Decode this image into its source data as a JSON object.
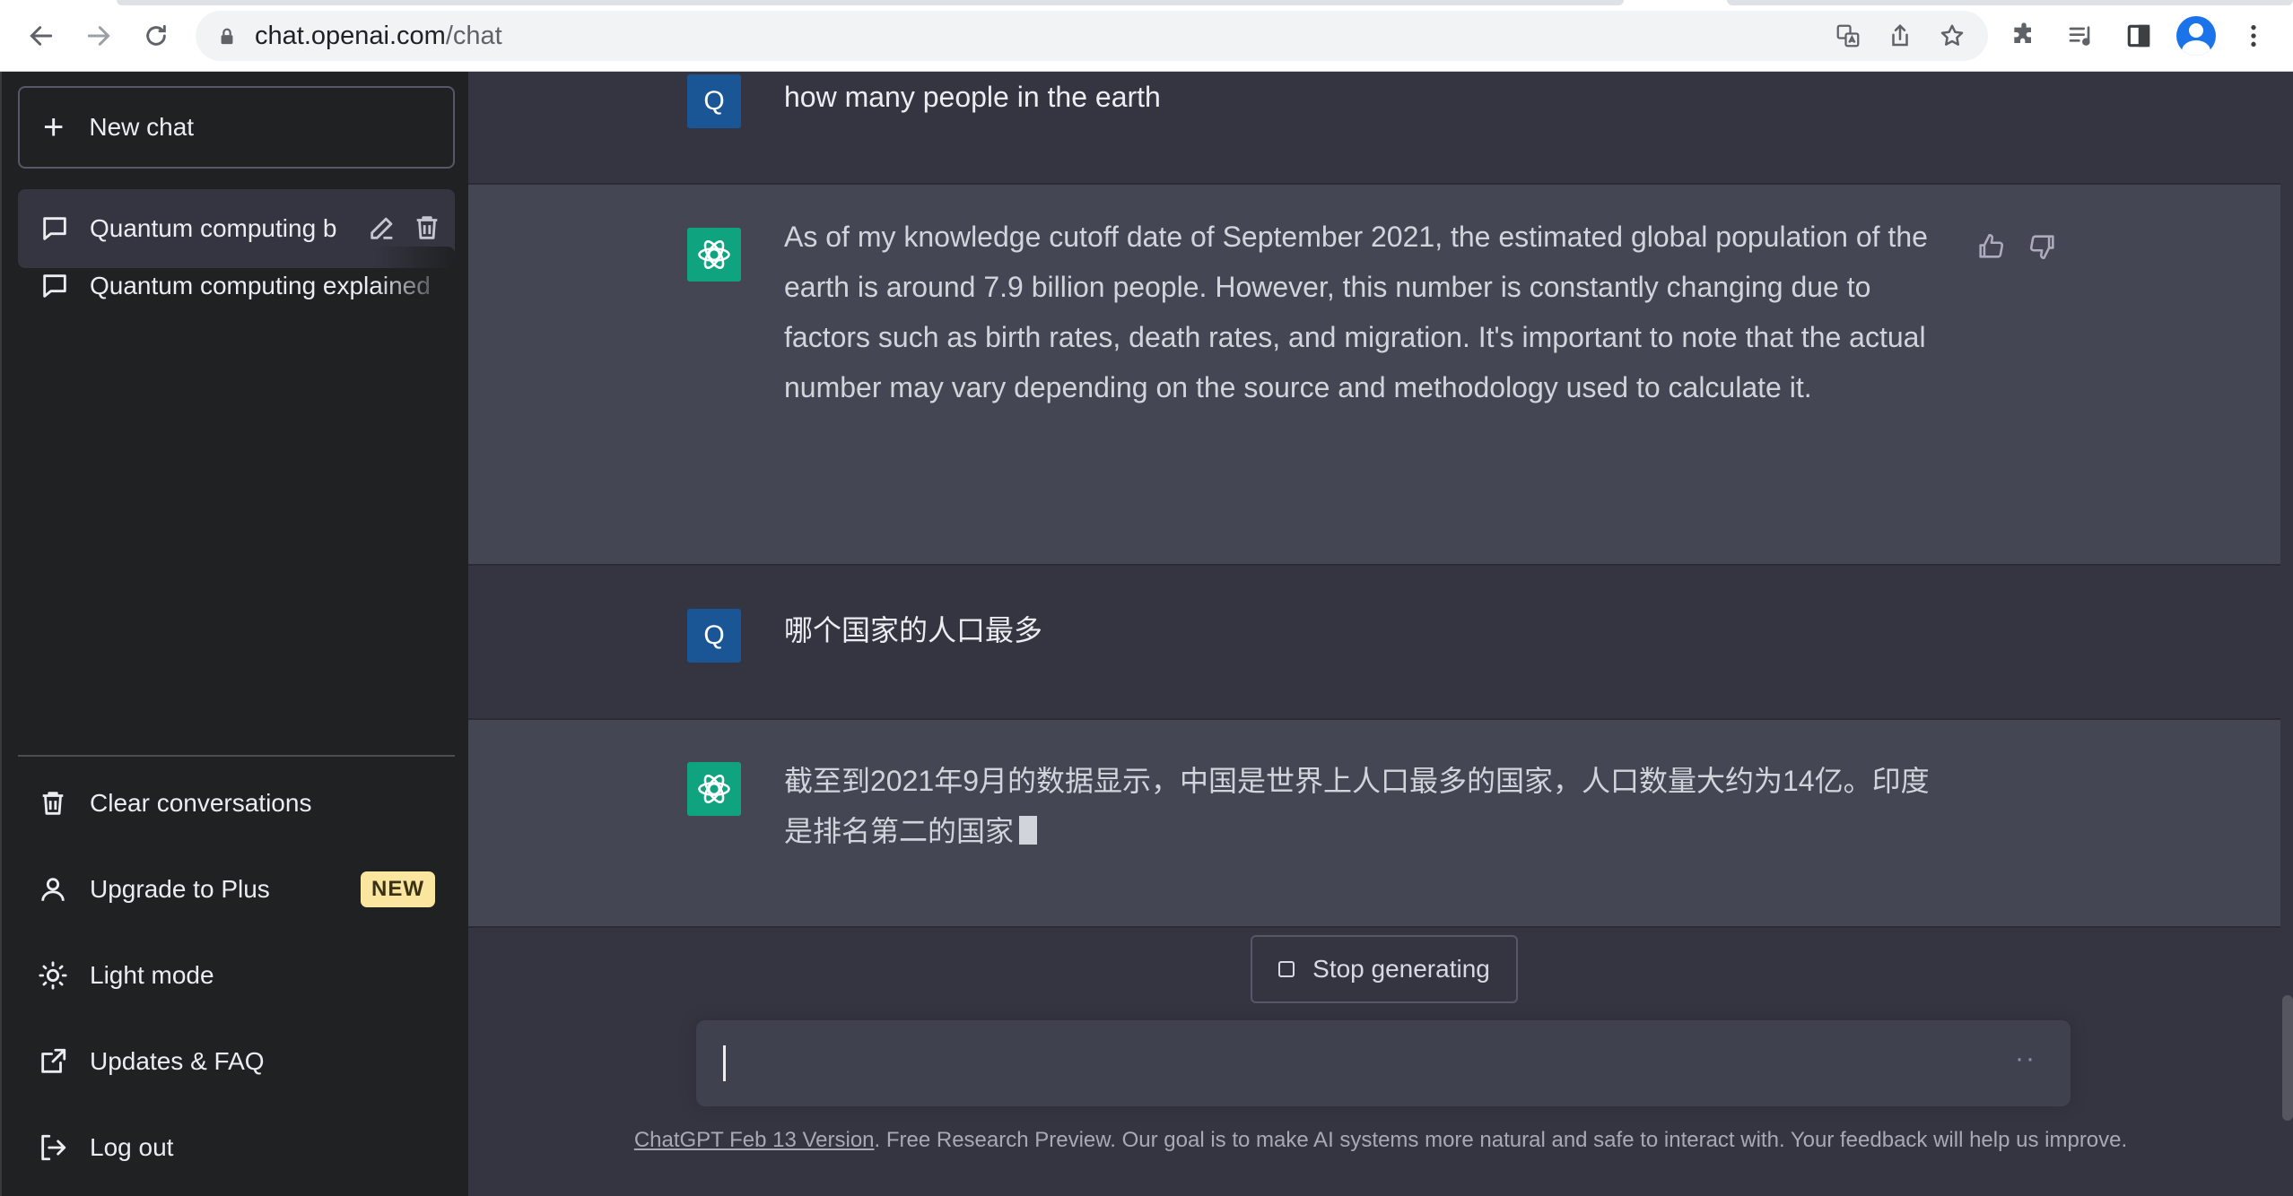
{
  "browser": {
    "url_host": "chat.openai.com",
    "url_path": "/chat"
  },
  "sidebar": {
    "new_chat": "New chat",
    "conversations": [
      {
        "title": "Quantum computing b"
      },
      {
        "title": "Quantum computing explained"
      }
    ],
    "menu": {
      "clear": "Clear conversations",
      "upgrade": "Upgrade to Plus",
      "upgrade_badge": "NEW",
      "light_mode": "Light mode",
      "updates": "Updates & FAQ",
      "logout": "Log out"
    }
  },
  "messages": [
    {
      "role": "user",
      "avatar": "Q",
      "text": "how many people in the earth"
    },
    {
      "role": "assistant",
      "text": "As of my knowledge cutoff date of September 2021, the estimated global population of the earth is around 7.9 billion people. However, this number is constantly changing due to factors such as birth rates, death rates, and migration. It's important to note that the actual number may vary depending on the source and methodology used to calculate it."
    },
    {
      "role": "user",
      "avatar": "Q",
      "text": "哪个国家的人口最多"
    },
    {
      "role": "assistant",
      "text": "截至到2021年9月的数据显示，中国是世界上人口最多的国家，人口数量大约为14亿。印度是排名第二的国家"
    }
  ],
  "controls": {
    "stop_generating": "Stop generating",
    "composer_placeholder": ""
  },
  "footer": {
    "version_link": "ChatGPT Feb 13 Version",
    "text": ". Free Research Preview. Our goal is to make AI systems more natural and safe to interact with. Your feedback will help us improve."
  },
  "colors": {
    "sidebar_bg": "#202123",
    "main_bg": "#343541",
    "assistant_bg": "#444654",
    "user_avatar": "#1a5596",
    "assistant_avatar": "#10a37f",
    "badge_bg": "#fae69e"
  }
}
